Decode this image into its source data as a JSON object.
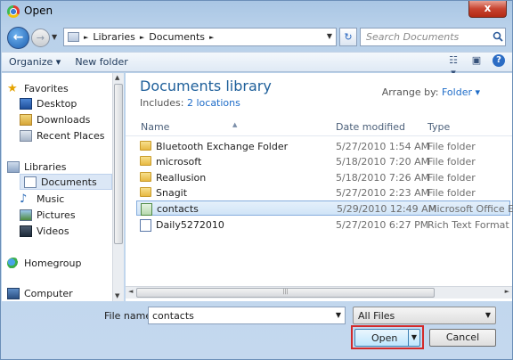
{
  "window": {
    "title": "Open",
    "close_glyph": "x"
  },
  "address": {
    "breadcrumb": [
      "Libraries",
      "Documents"
    ],
    "separator": "►",
    "search_placeholder": "Search Documents"
  },
  "toolbar": {
    "organize": "Organize ▾",
    "new_folder": "New folder"
  },
  "nav": {
    "favorites": "Favorites",
    "desktop": "Desktop",
    "downloads": "Downloads",
    "recent_places": "Recent Places",
    "libraries": "Libraries",
    "documents": "Documents",
    "music": "Music",
    "pictures": "Pictures",
    "videos": "Videos",
    "homegroup": "Homegroup",
    "computer": "Computer"
  },
  "library": {
    "title": "Documents library",
    "includes_label": "Includes:",
    "includes_link": "2 locations",
    "arrange_label": "Arrange by:",
    "arrange_value": "Folder ▾"
  },
  "columns": {
    "name": "Name",
    "date": "Date modified",
    "type": "Type"
  },
  "files": [
    {
      "name": "Bluetooth Exchange Folder",
      "date": "5/27/2010 1:54 AM",
      "type": "File folder",
      "icon": "folder-icon"
    },
    {
      "name": "microsoft",
      "date": "5/18/2010 7:20 AM",
      "type": "File folder",
      "icon": "folder-icon"
    },
    {
      "name": "Reallusion",
      "date": "5/18/2010 7:26 AM",
      "type": "File folder",
      "icon": "folder-icon"
    },
    {
      "name": "Snagit",
      "date": "5/27/2010 2:23 AM",
      "type": "File folder",
      "icon": "folder-icon"
    },
    {
      "name": "contacts",
      "date": "5/29/2010 12:49 AM",
      "type": "Microsoft Office E...",
      "icon": "excel-file-icon"
    },
    {
      "name": "Daily5272010",
      "date": "5/27/2010 6:27 PM",
      "type": "Rich Text Format",
      "icon": "rtf-file-icon"
    }
  ],
  "bottom": {
    "file_name_label": "File name:",
    "file_name_value": "contacts",
    "filter_value": "All Files",
    "open_label": "Open",
    "cancel_label": "Cancel"
  },
  "colors": {
    "link": "#1e6cc8",
    "title_blue": "#1e5f9a",
    "highlight_red": "#d32a2a",
    "close_red": "#c7432f"
  }
}
